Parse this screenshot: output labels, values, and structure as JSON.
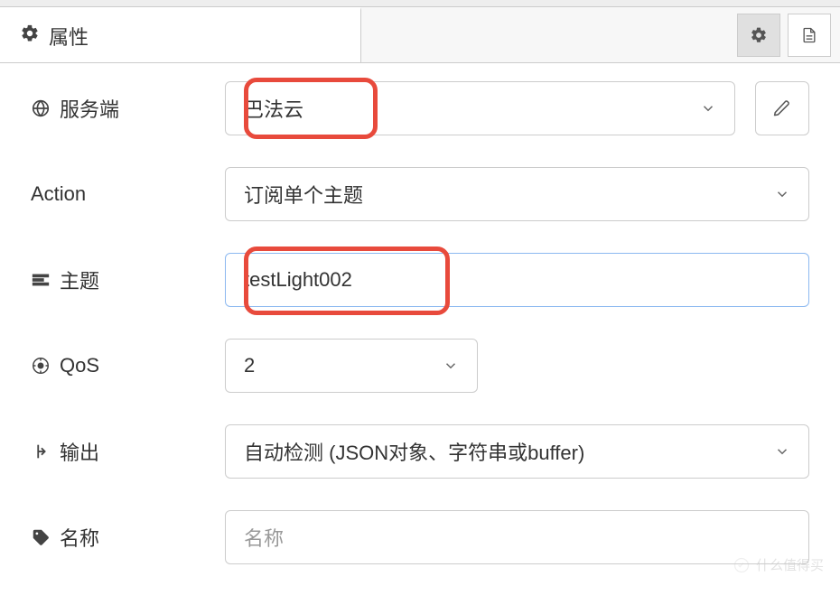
{
  "header": {
    "tab_label": "属性"
  },
  "form": {
    "server": {
      "label": "服务端",
      "value": "巴法云"
    },
    "action": {
      "label": "Action",
      "value": "订阅单个主题"
    },
    "topic": {
      "label": "主题",
      "value": "testLight002"
    },
    "qos": {
      "label": "QoS",
      "value": "2"
    },
    "output": {
      "label": "输出",
      "value": "自动检测 (JSON对象、字符串或buffer)"
    },
    "name": {
      "label": "名称",
      "placeholder": "名称"
    }
  },
  "watermark": "什么值得买",
  "highlight_color": "#e84a3c"
}
